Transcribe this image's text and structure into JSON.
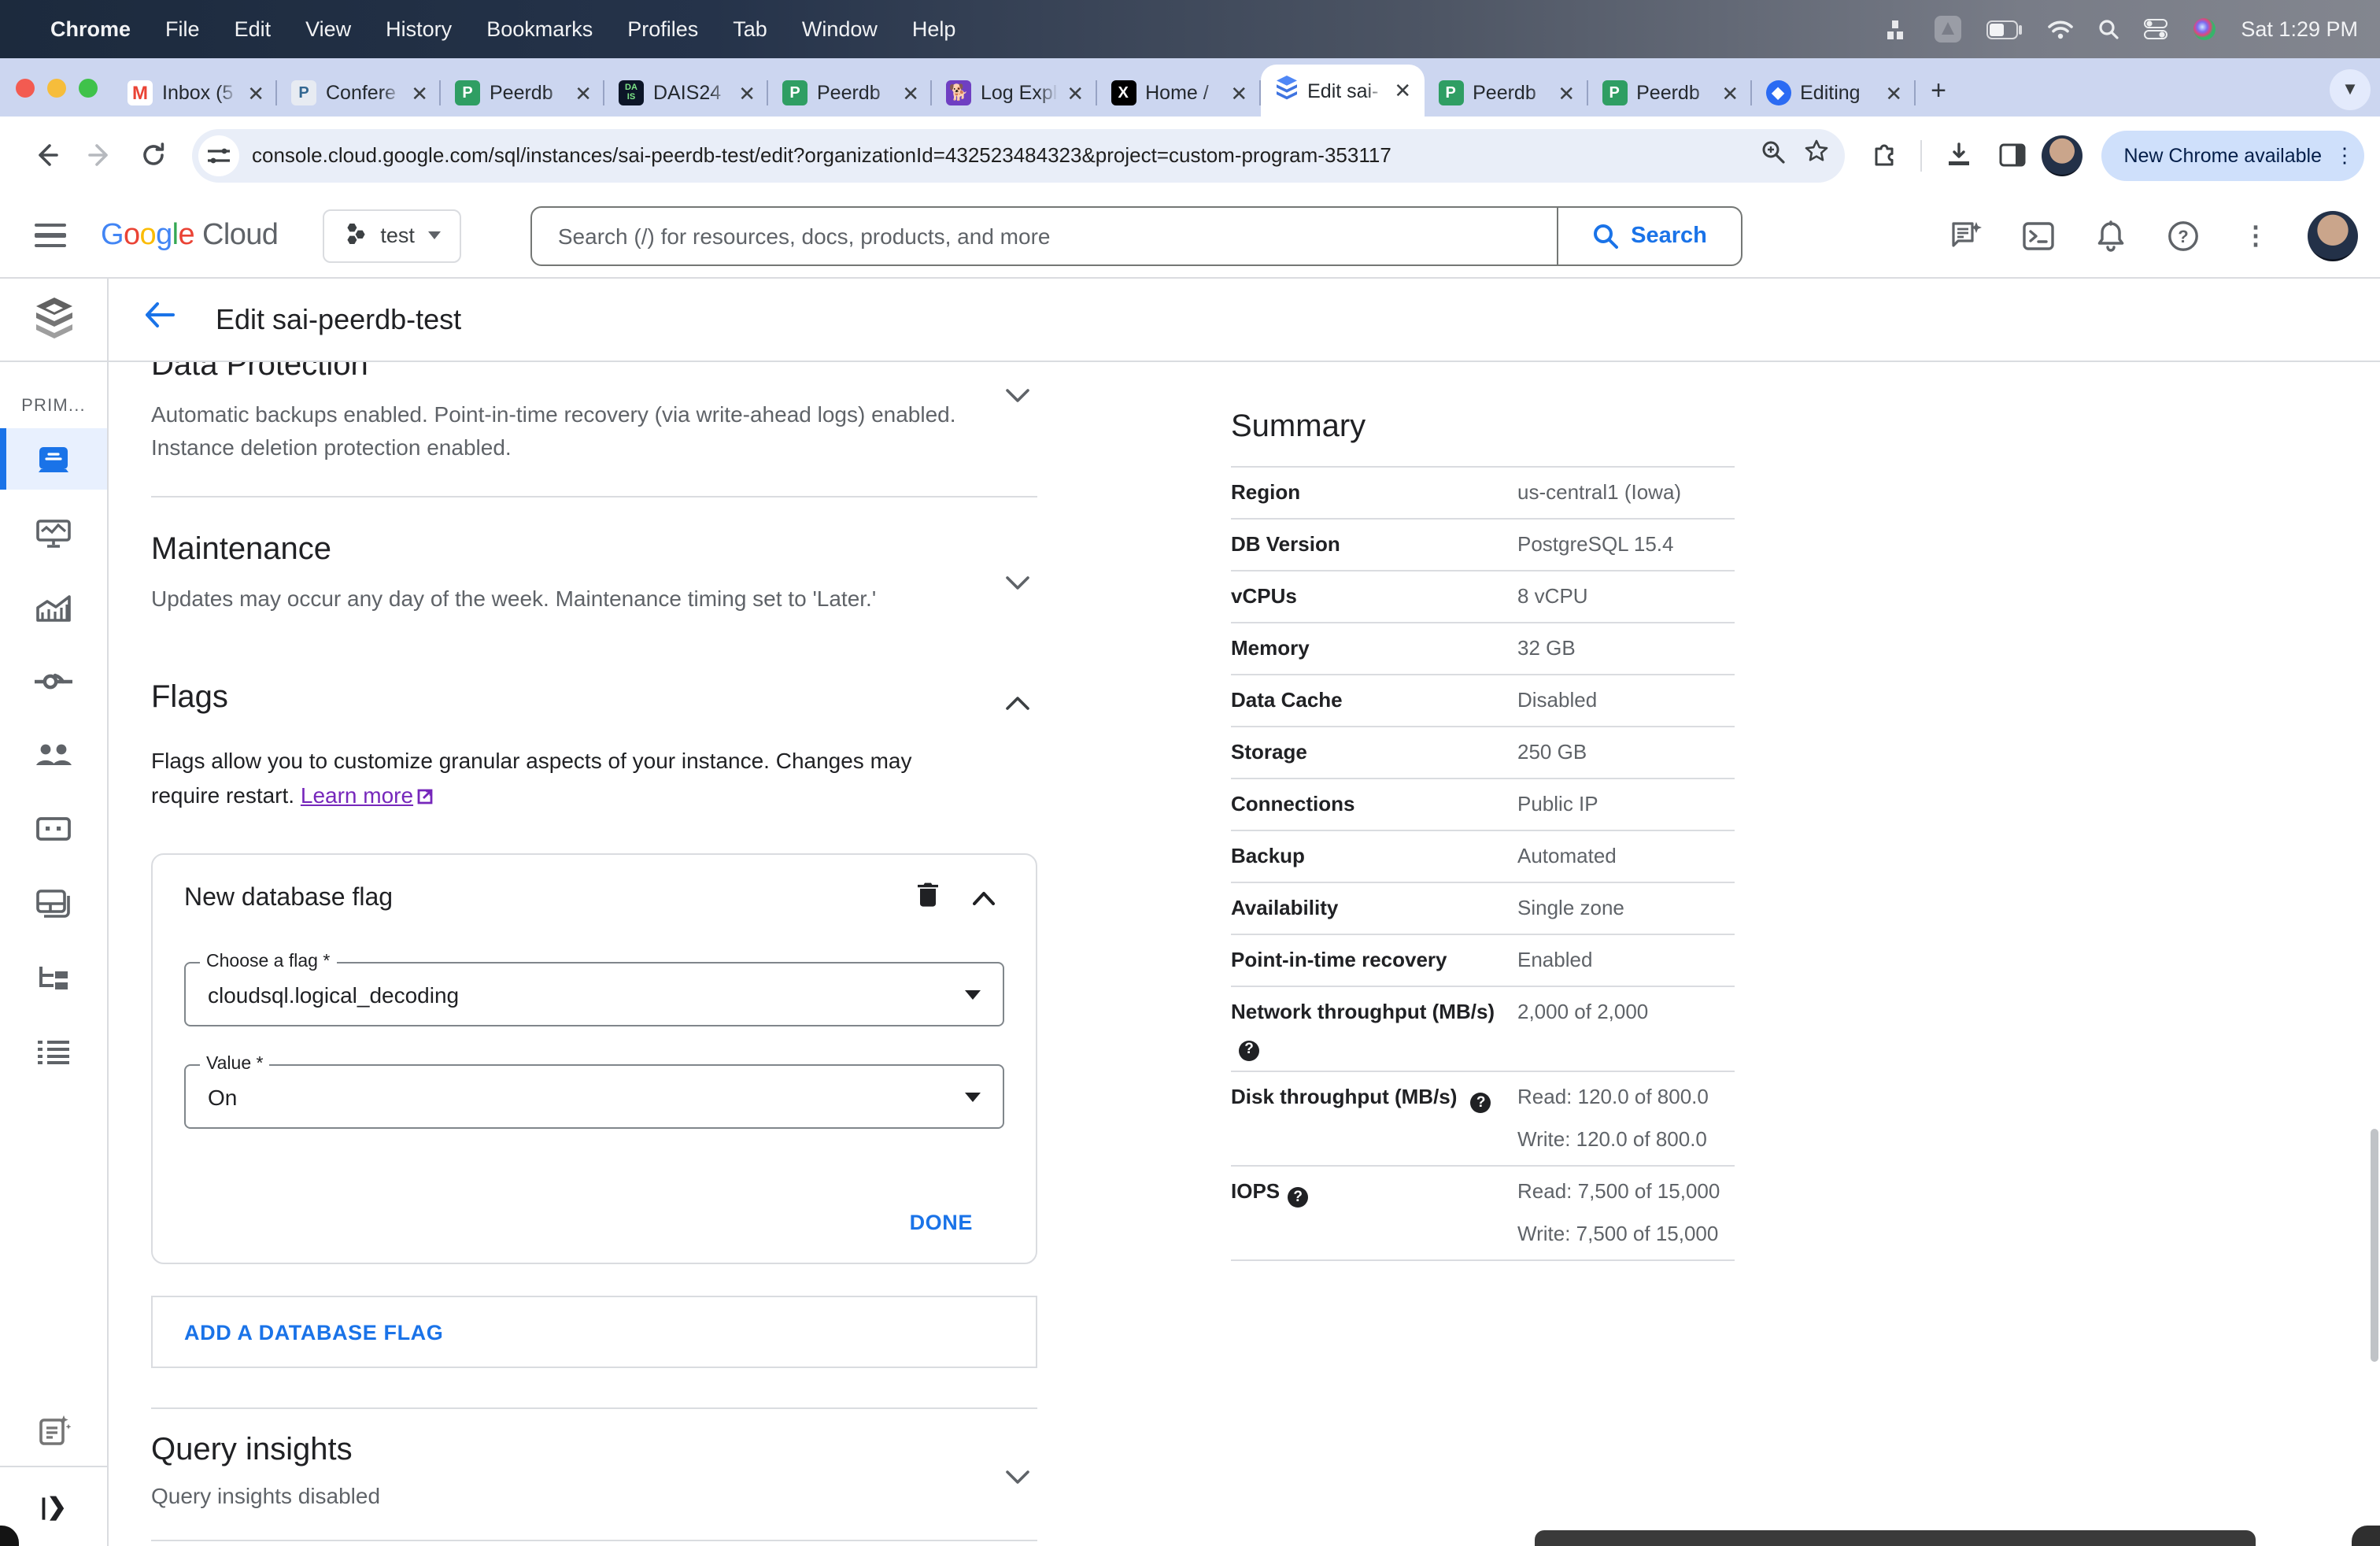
{
  "menubar": {
    "items": [
      "Chrome",
      "File",
      "Edit",
      "View",
      "History",
      "Bookmarks",
      "Profiles",
      "Tab",
      "Window",
      "Help"
    ],
    "clock": "Sat 1:29 PM"
  },
  "tabs": [
    {
      "label": "Inbox (5",
      "icon": "gmail"
    },
    {
      "label": "Confere",
      "icon": "postgresql"
    },
    {
      "label": "Peerdb",
      "icon": "peerdb"
    },
    {
      "label": "DAIS24",
      "icon": "dais"
    },
    {
      "label": "Peerdb",
      "icon": "peerdb"
    },
    {
      "label": "Log Expl",
      "icon": "log-explorer"
    },
    {
      "label": "Home /",
      "icon": "x"
    },
    {
      "label": "Edit sai-",
      "icon": "cloud-sql"
    },
    {
      "label": "Peerdb",
      "icon": "peerdb"
    },
    {
      "label": "Peerdb",
      "icon": "peerdb"
    },
    {
      "label": "Editing",
      "icon": "editing"
    }
  ],
  "toolbar": {
    "url": "console.cloud.google.com/sql/instances/sai-peerdb-test/edit?organizationId=432523484323&project=custom-program-353117",
    "update_button": "New Chrome available"
  },
  "cloudbar": {
    "logo_google": "Google",
    "logo_cloud": "Cloud",
    "project": "test",
    "search_placeholder": "Search (/) for resources, docs, products, and more",
    "search_button": "Search"
  },
  "titlebar": {
    "title": "Edit sai-peerdb-test"
  },
  "sidebar": {
    "section_label": "PRIM..."
  },
  "main": {
    "data_protection": {
      "title": "Data Protection",
      "description": "Automatic backups enabled. Point-in-time recovery (via write-ahead logs) enabled. Instance deletion protection enabled."
    },
    "maintenance": {
      "title": "Maintenance",
      "description": "Updates may occur any day of the week. Maintenance timing set to 'Later.'"
    },
    "flags": {
      "title": "Flags",
      "description": "Flags allow you to customize granular aspects of your instance. Changes may require restart. ",
      "learn_more": "Learn more"
    },
    "flag_card": {
      "title": "New database flag",
      "flag_label": "Choose a flag *",
      "flag_value": "cloudsql.logical_decoding",
      "value_label": "Value *",
      "value_value": "On",
      "done_button": "DONE"
    },
    "add_flag_button": "ADD A DATABASE FLAG",
    "query_insights": {
      "title": "Query insights",
      "status": "Query insights disabled"
    }
  },
  "summary": {
    "title": "Summary",
    "rows": [
      {
        "label": "Region",
        "value": "us-central1 (Iowa)"
      },
      {
        "label": "DB Version",
        "value": "PostgreSQL 15.4"
      },
      {
        "label": "vCPUs",
        "value": "8 vCPU"
      },
      {
        "label": "Memory",
        "value": "32 GB"
      },
      {
        "label": "Data Cache",
        "value": "Disabled"
      },
      {
        "label": "Storage",
        "value": "250 GB"
      },
      {
        "label": "Connections",
        "value": "Public IP"
      },
      {
        "label": "Backup",
        "value": "Automated"
      },
      {
        "label": "Availability",
        "value": "Single zone"
      },
      {
        "label": "Point-in-time recovery",
        "value": "Enabled"
      },
      {
        "label": "Network throughput (MB/s)",
        "value": "2,000 of 2,000"
      },
      {
        "label": "Disk throughput (MB/s)",
        "value": "Read: 120.0 of 800.0",
        "value2": "Write: 120.0 of 800.0"
      },
      {
        "label": "IOPS",
        "value": "Read: 7,500 of 15,000",
        "value2": "Write: 7,500 of 15,000"
      }
    ]
  }
}
